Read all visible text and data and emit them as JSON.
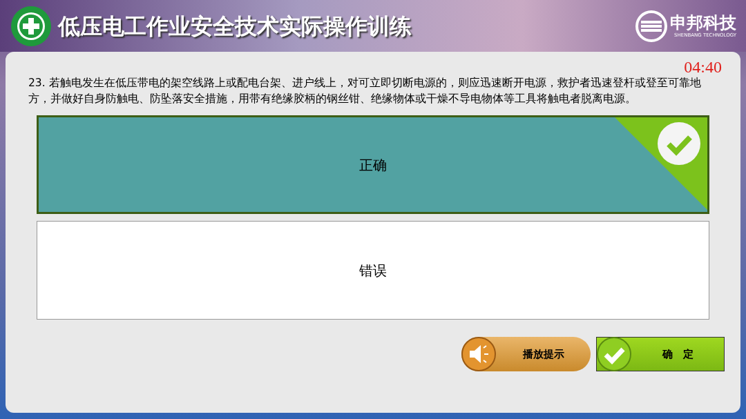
{
  "header": {
    "title": "低压电工作业安全技术实际操作训练",
    "brand": "申邦科技",
    "brand_subtitle": "SHENBANG TECHNOLOGY"
  },
  "timer": "04:40",
  "question": "23. 若触电发生在低压带电的架空线路上或配电台架、进户线上，对可立即切断电源的，则应迅速断开电源，救护者迅速登杆或登至可靠地方，并做好自身防触电、防坠落安全措施，用带有绝缘胶柄的钢丝钳、绝缘物体或干燥不导电物体等工具将触电者脱离电源。",
  "options": [
    {
      "label": "正确",
      "selected": true
    },
    {
      "label": "错误",
      "selected": false
    }
  ],
  "buttons": [
    {
      "kind": "audio",
      "label": "播放提示"
    },
    {
      "kind": "confirm",
      "label": "确　定"
    }
  ]
}
